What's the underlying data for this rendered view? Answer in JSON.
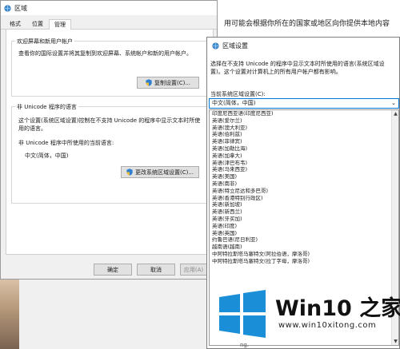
{
  "background": {
    "text": "用可能会根据你所在的国家或地区向你提供本地内容",
    "footer": "ng."
  },
  "region_dialog": {
    "title": "区域",
    "tabs": [
      "格式",
      "位置",
      "管理"
    ],
    "group1": {
      "title": "欢迎屏幕和新用户帐户",
      "text": "查看你的国际设置并将其复制到欢迎屏幕、系统帐户和新的用户帐户。",
      "button": "复制设置(C)..."
    },
    "group2": {
      "title": "非 Unicode 程序的语言",
      "text": "这个设置(系统区域设置)控制在不支持 Unicode 的程序中显示文本时所使用的语言。",
      "current_label": "非 Unicode 程序中所使用的当前语言:",
      "current_value": "中文(简体，中国)",
      "button": "更改系统区域设置(C)..."
    },
    "buttons": {
      "ok": "确定",
      "cancel": "取消",
      "apply": "应用(A)"
    }
  },
  "region_settings": {
    "title": "区域设置",
    "description": "选择在不支持 Unicode 的程序中显示文本时所使用的语言(系统区域设置)。这个设置对计算机上的所有用户帐户都有影响。",
    "label": "当前系统区域设置(C):",
    "selected": "中文(简体，中国)",
    "options": [
      "印度尼西亚语(印度尼西亚)",
      "英语(爱尔兰)",
      "英语(澳大利亚)",
      "英语(伯利兹)",
      "英语(菲律宾)",
      "英语(加勒比海)",
      "英语(加拿大)",
      "英语(津巴布韦)",
      "英语(马来西亚)",
      "英语(美国)",
      "英语(南非)",
      "英语(特立尼达和多巴哥)",
      "英语(香港特别行政区)",
      "英语(新加坡)",
      "英语(新西兰)",
      "英语(牙买加)",
      "英语(印度)",
      "英语(英国)",
      "约鲁巴语(尼日利亚)",
      "越南语(越南)",
      "中阿特拉斯塔马塞特文(阿拉伯语，摩洛哥)",
      "中阿特拉斯塔马塞特文(拉丁字母，摩洛哥)"
    ]
  },
  "watermark": {
    "text": "Win10 之家",
    "url": "www.win10xitong.com",
    "logo_color": "#1a8fd8",
    "icon": "windows-logo-icon"
  },
  "colors": {
    "accent": "#0078d7",
    "window_bg": "#f0f0f0",
    "button_bg": "#e1e1e1"
  }
}
